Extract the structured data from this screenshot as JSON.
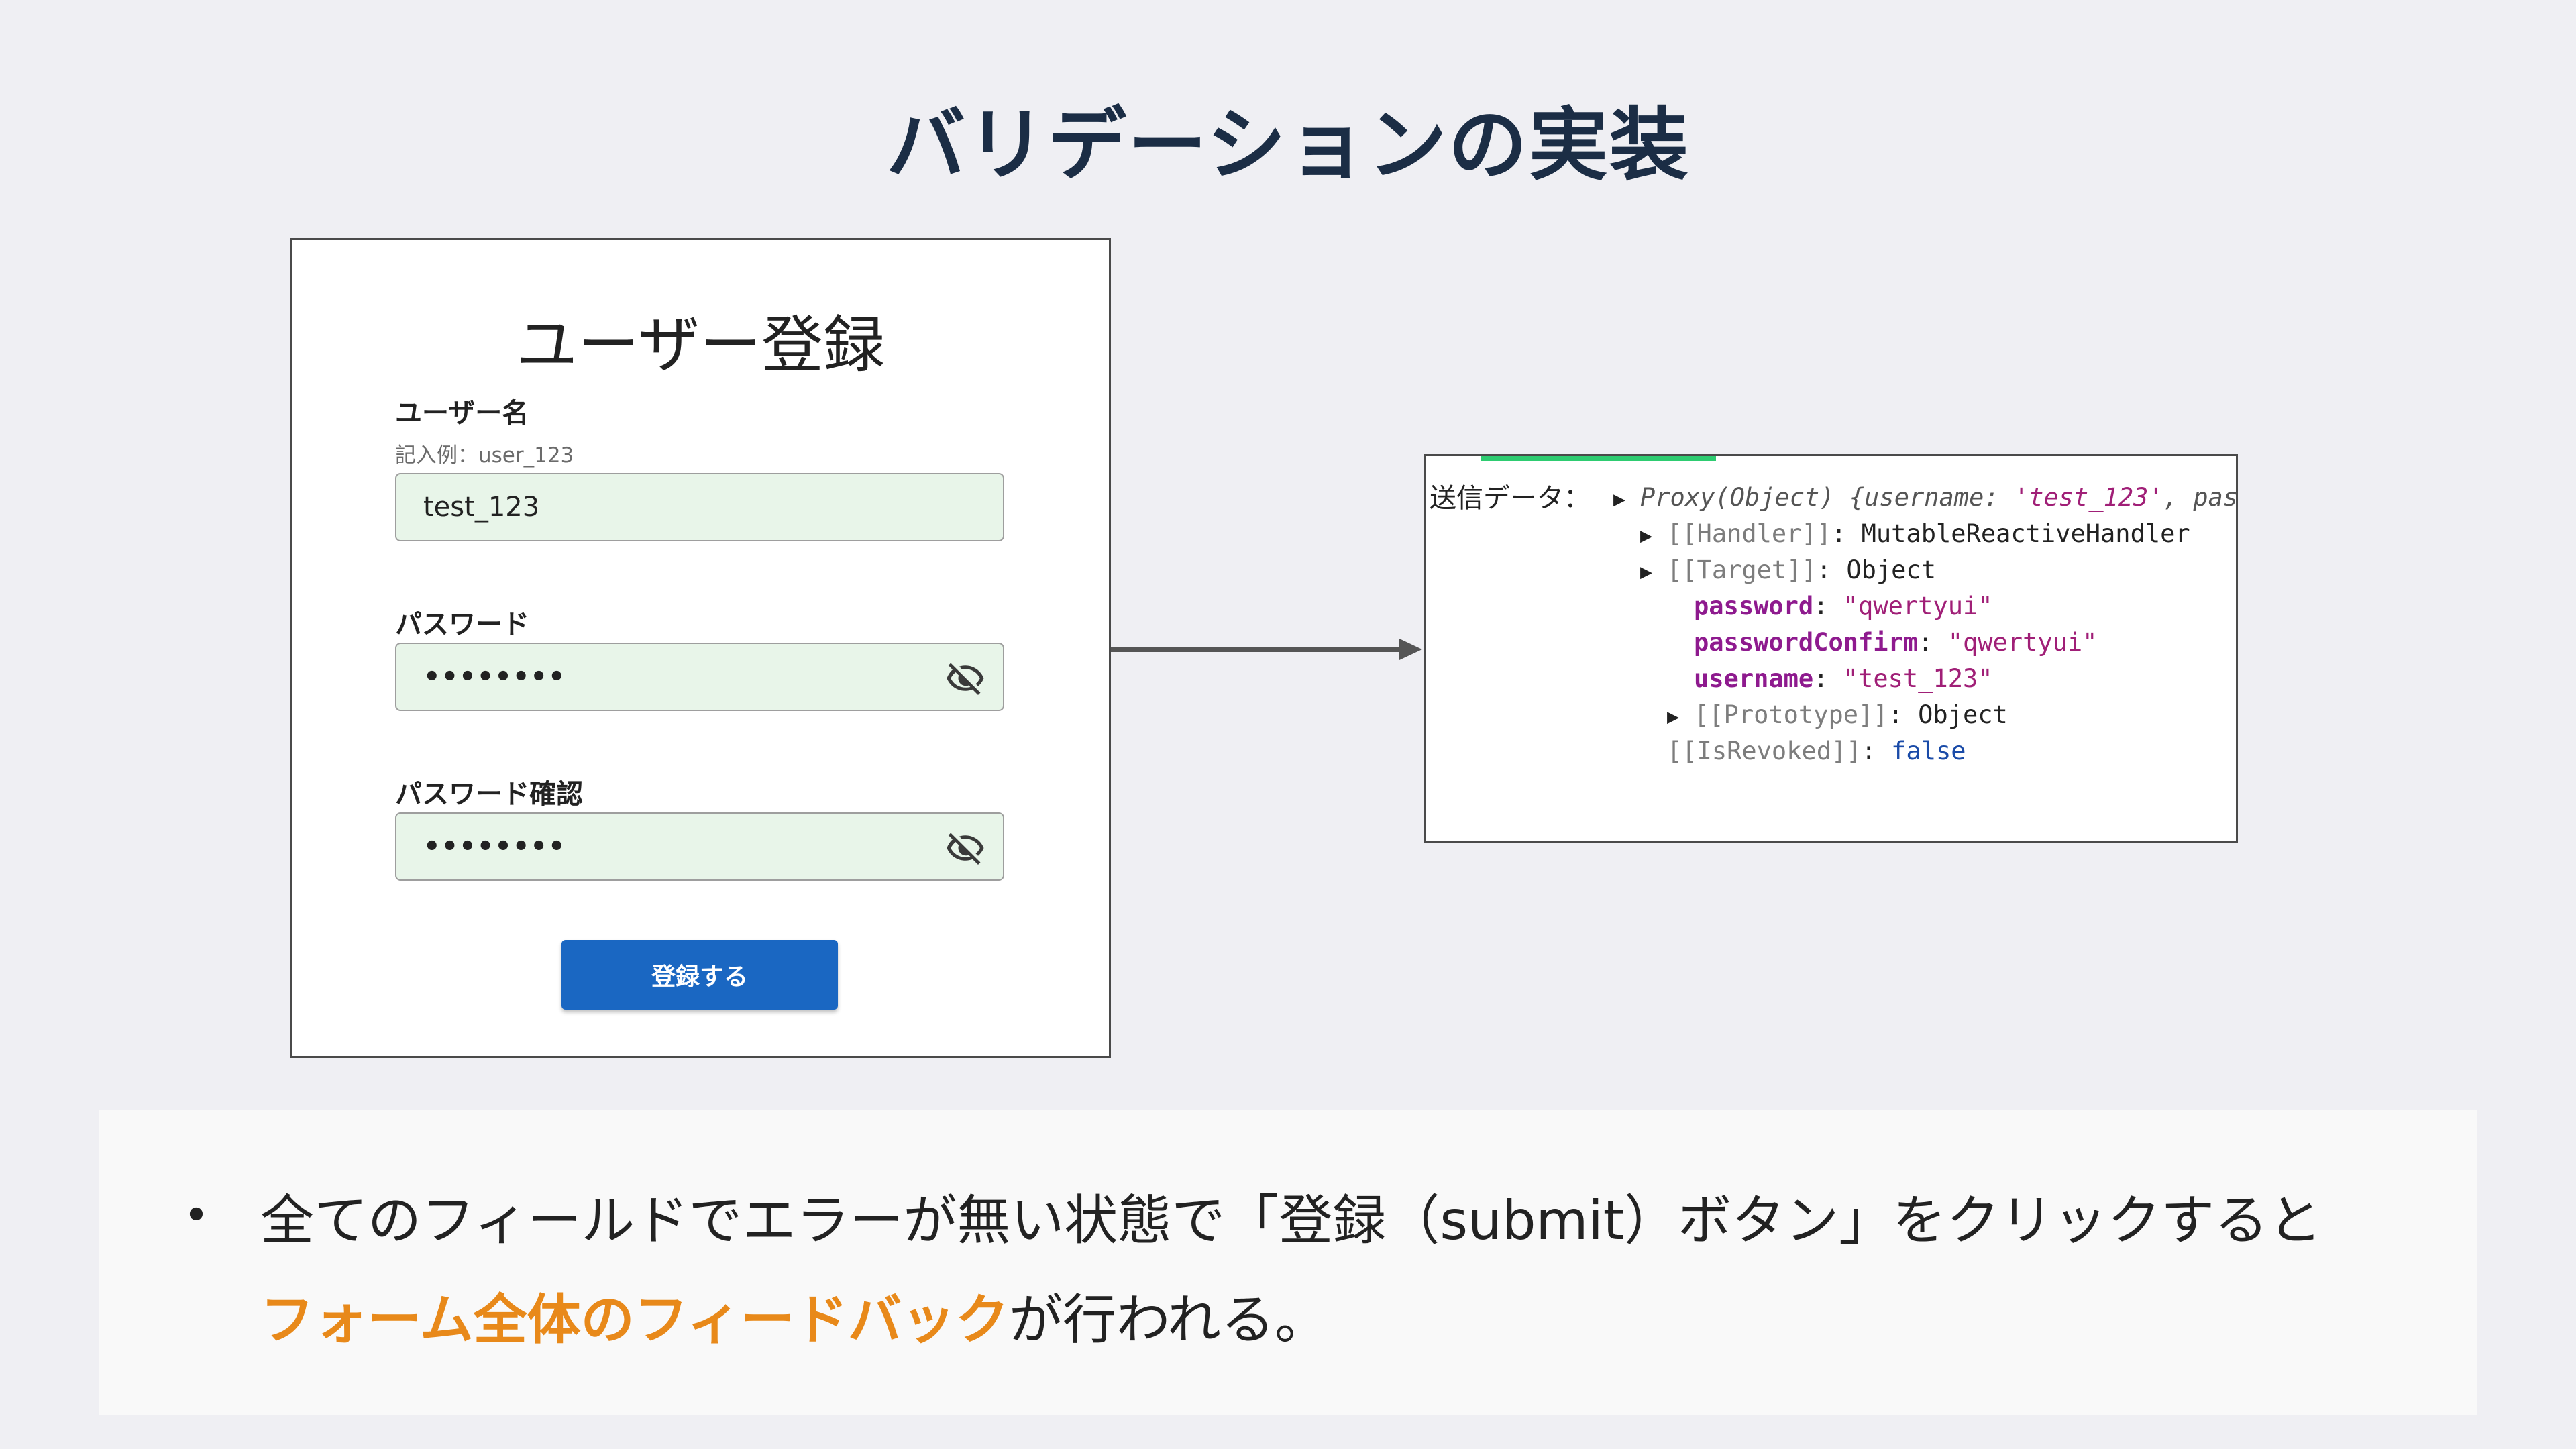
{
  "slide": {
    "title": "バリデーションの実装"
  },
  "form": {
    "title": "ユーザー登録",
    "username": {
      "label": "ユーザー名",
      "hint": "記入例：user_123",
      "value": "test_123"
    },
    "password": {
      "label": "パスワード",
      "masked_value": "••••••••",
      "toggle_icon": "eye-off-icon"
    },
    "password_confirm": {
      "label": "パスワード確認",
      "masked_value": "••••••••",
      "toggle_icon": "eye-off-icon"
    },
    "submit_label": "登録する",
    "submit_color": "#1a67c2",
    "input_bg_color": "#e8f5e9"
  },
  "console": {
    "label": "送信データ：",
    "accent_color": "#2ecc71",
    "proxy_prefix": "Proxy(Object) ",
    "proxy_brace": "{",
    "proxy_key": "username",
    "proxy_sep": ": ",
    "proxy_value": "'test_123'",
    "proxy_rest": ", pas",
    "handler_key": "[[Handler]]",
    "handler_value": "MutableReactiveHandler",
    "target_key": "[[Target]]",
    "target_value": "Object",
    "props": [
      {
        "key": "password",
        "value": "\"qwertyui\""
      },
      {
        "key": "passwordConfirm",
        "value": "\"qwertyui\""
      },
      {
        "key": "username",
        "value": "\"test_123\""
      }
    ],
    "prototype_key": "[[Prototype]]",
    "prototype_value": "Object",
    "revoked_key": "[[IsRevoked]]",
    "revoked_value": "false"
  },
  "note": {
    "bullet": "•",
    "line1": "全てのフィールドでエラーが無い状態で「登録（submit）ボタン」をクリックすると",
    "highlight": "フォーム全体のフィードバック",
    "line2_rest": "が行われる。",
    "highlight_color": "#e8891a"
  }
}
